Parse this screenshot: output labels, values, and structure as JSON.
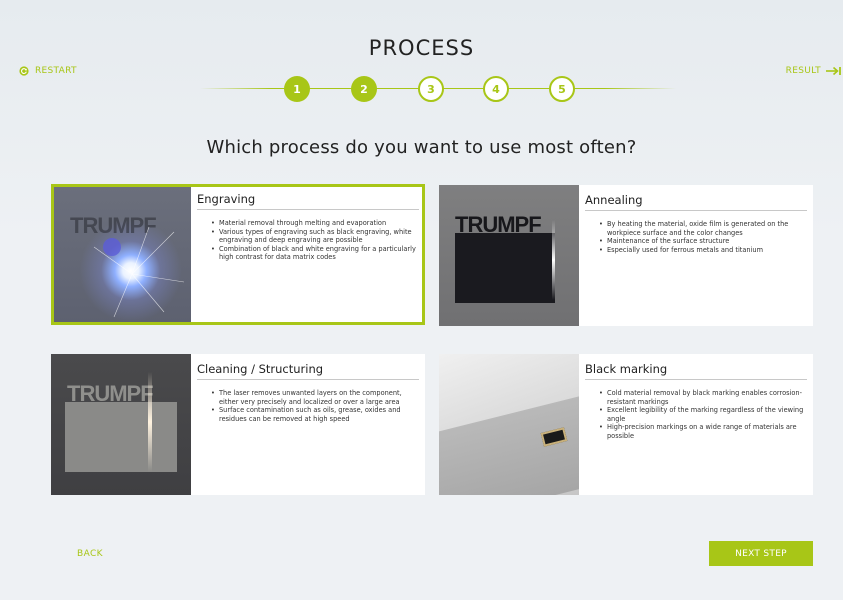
{
  "nav": {
    "restart_label": "RESTART",
    "result_label": "RESULT"
  },
  "page": {
    "title": "PROCESS",
    "question": "Which process do you want to use most often?"
  },
  "stepper": {
    "steps": [
      {
        "label": "1",
        "state": "done"
      },
      {
        "label": "2",
        "state": "done"
      },
      {
        "label": "3",
        "state": "todo"
      },
      {
        "label": "4",
        "state": "todo"
      },
      {
        "label": "5",
        "state": "todo"
      }
    ]
  },
  "colors": {
    "accent": "#a8c617",
    "background": "#eef1f4"
  },
  "cards": [
    {
      "title": "Engraving",
      "selected": true,
      "image": "engraving-laser-spark",
      "bullets": [
        "Material removal through melting and evaporation",
        "Various types of engraving such as black engraving, white engraving and deep engraving are possible",
        "Combination of black and white engraving for a particularly high contrast for data matrix codes"
      ]
    },
    {
      "title": "Annealing",
      "selected": false,
      "image": "annealing-dark-logo",
      "bullets": [
        "By heating the material, oxide film is generated on the workpiece surface and the color changes",
        "Maintenance of the surface structure",
        "Especially used for ferrous metals and titanium"
      ]
    },
    {
      "title": "Cleaning / Structuring",
      "selected": false,
      "image": "cleaning-laser-line",
      "bullets": [
        "The laser removes unwanted layers on the component, either very precisely and localized or over a large area",
        "Surface contamination such as oils, grease, oxides and residues can be removed at high speed"
      ]
    },
    {
      "title": "Black marking",
      "selected": false,
      "image": "black-marking-part",
      "bullets": [
        "Cold material removal by black marking enables corrosion-resistant markings",
        "Excellent legibility of the marking regardless of the viewing angle",
        "High-precision markings on a wide range of materials are possible"
      ]
    }
  ],
  "images": {
    "logo_text": "TRUMPF"
  },
  "footer": {
    "back_label": "BACK",
    "next_label": "NEXT STEP"
  }
}
